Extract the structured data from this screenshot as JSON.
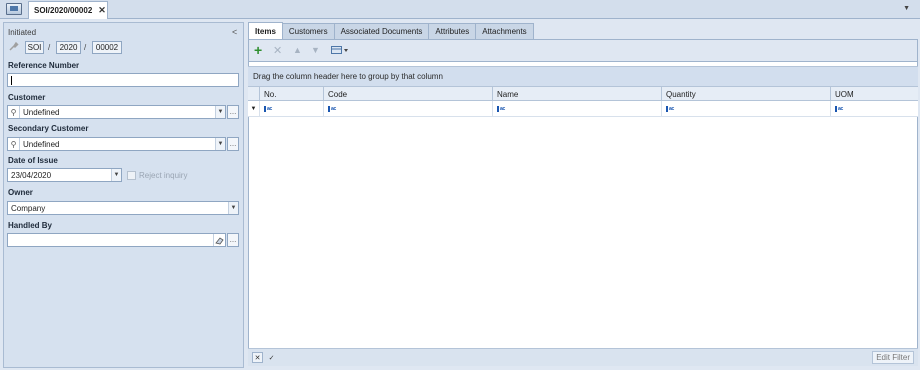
{
  "window": {
    "document_tab": "SOI/2020/00002",
    "close_glyph": "✕",
    "app_icon": "window-icon"
  },
  "header": {
    "status": "Initiated",
    "collapse_glyph": "<",
    "number": {
      "series": "SOI",
      "year": "2020",
      "seq": "00002"
    }
  },
  "form": {
    "reference_number_label": "Reference Number",
    "reference_number_value": "",
    "customer_label": "Customer",
    "customer_value": "Undefined",
    "secondary_customer_label": "Secondary Customer",
    "secondary_customer_value": "Undefined",
    "date_of_issue_label": "Date of Issue",
    "date_of_issue_value": "23/04/2020",
    "reject_inquiry_label": "Reject inquiry",
    "owner_label": "Owner",
    "owner_value": "Company",
    "handled_by_label": "Handled By",
    "handled_by_value": "",
    "dots_glyph": "…"
  },
  "tabs": [
    "Items",
    "Customers",
    "Associated Documents",
    "Attributes",
    "Attachments"
  ],
  "grid": {
    "group_hint": "Drag the column header here to group by that column",
    "columns": [
      "No.",
      "Code",
      "Name",
      "Quantity",
      "UOM"
    ],
    "filter_row_glyph": "▼",
    "filter_cell_icon": "abc-filter-icon",
    "edit_filter_label": "Edit Filter"
  },
  "colors": {
    "accent": "#2f8f2f",
    "panel_bg": "#d6e1ef",
    "border": "#9fb3cc"
  }
}
